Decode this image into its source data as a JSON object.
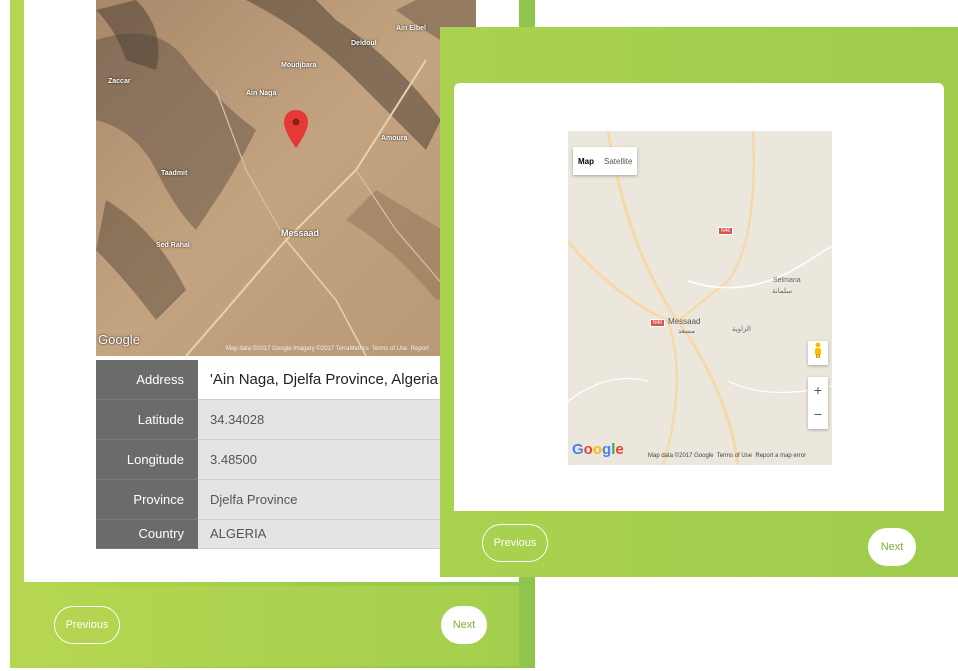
{
  "left_panel": {
    "satellite_map": {
      "place_labels": [
        "Messaad",
        "Ain Naga",
        "Ain Elbel",
        "Amoura",
        "Taadmit",
        "Moudjbara",
        "Sed Rahal",
        "Zaccar",
        "Deldoul"
      ],
      "google_label": "Google",
      "attribution": "Map data ©2017 Google Imagery ©2017 TerraMetrics",
      "terms": "Terms of Use",
      "report": "Report"
    },
    "info": [
      {
        "key": "Address",
        "value": "'Ain Naga, Djelfa Province, Algeria"
      },
      {
        "key": "Latitude",
        "value": "34.34028"
      },
      {
        "key": "Longitude",
        "value": "3.48500"
      },
      {
        "key": "Province",
        "value": "Djelfa Province"
      },
      {
        "key": "Country",
        "value": "ALGERIA"
      }
    ],
    "previous_label": "Previous",
    "next_label": "Next"
  },
  "right_panel": {
    "road_map": {
      "type_map": "Map",
      "type_satellite": "Satellite",
      "place_messaad": "Messaad",
      "place_messaad_ar": "مسعد",
      "place_selmana": "Selmana",
      "place_selmana_ar": "سلمانة",
      "place_zaouia_ar": "الزاوية",
      "highway_1": "N46",
      "highway_2": "N46",
      "zoom_in": "+",
      "zoom_out": "−",
      "google_label": "Google",
      "attribution": "Map data ©2017 Google",
      "terms": "Terms of Use",
      "report": "Report a map error"
    },
    "previous_label": "Previous",
    "next_label": "Next"
  },
  "colors": {
    "accent_green": "#9ccc4c",
    "marker_red": "#e53935"
  }
}
